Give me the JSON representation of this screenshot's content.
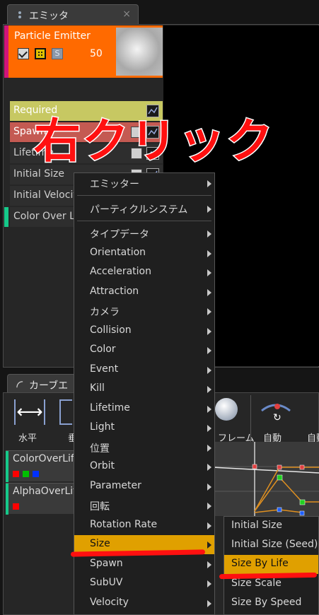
{
  "emitter_tab": {
    "label": "エミッタ",
    "close": "×"
  },
  "emitter": {
    "name": "Particle Emitter",
    "count": "50",
    "solo_label": "S",
    "modules": [
      {
        "label": "Required"
      },
      {
        "label": "Spawn"
      },
      {
        "label": "Lifetime"
      },
      {
        "label": "Initial Size"
      },
      {
        "label": "Initial Velocity"
      },
      {
        "label": "Color Over Life"
      }
    ]
  },
  "annotation": {
    "text": "右クリック",
    "color": "#ff1010"
  },
  "curve_tab": {
    "label": "カーブエディタ"
  },
  "curve_toolbar": {
    "horizontal": "水平",
    "vertical": "垂直",
    "frame": "フレーム",
    "auto": "自動",
    "auto2": "自動"
  },
  "curve_tracks": [
    {
      "label": "ColorOverLife",
      "swatches": [
        "#ff0000",
        "#00c000",
        "#0030ff"
      ]
    },
    {
      "label": "AlphaOverLife",
      "swatches": [
        "#ff0000"
      ]
    }
  ],
  "context_menu": {
    "items": [
      {
        "label": "エミッター",
        "submenu": true
      },
      {
        "label": "パーティクルシステム",
        "submenu": true
      },
      {
        "label": "タイプデータ",
        "submenu": true
      },
      {
        "label": "Orientation",
        "submenu": true
      },
      {
        "label": "Acceleration",
        "submenu": true
      },
      {
        "label": "Attraction",
        "submenu": true
      },
      {
        "label": "カメラ",
        "submenu": true
      },
      {
        "label": "Collision",
        "submenu": true
      },
      {
        "label": "Color",
        "submenu": true
      },
      {
        "label": "Event",
        "submenu": true
      },
      {
        "label": "Kill",
        "submenu": true
      },
      {
        "label": "Lifetime",
        "submenu": true
      },
      {
        "label": "Light",
        "submenu": true
      },
      {
        "label": "位置",
        "submenu": true
      },
      {
        "label": "Orbit",
        "submenu": true
      },
      {
        "label": "Parameter",
        "submenu": true
      },
      {
        "label": "回転",
        "submenu": true
      },
      {
        "label": "Rotation Rate",
        "submenu": true
      },
      {
        "label": "Size",
        "submenu": true,
        "selected": true
      },
      {
        "label": "Spawn",
        "submenu": true
      },
      {
        "label": "SubUV",
        "submenu": true
      },
      {
        "label": "Velocity",
        "submenu": true
      }
    ]
  },
  "size_submenu": {
    "items": [
      {
        "label": "Initial Size"
      },
      {
        "label": "Initial Size (Seed)"
      },
      {
        "label": "Size By Life",
        "selected": true
      },
      {
        "label": "Size Scale"
      },
      {
        "label": "Size By Speed"
      }
    ]
  },
  "colors": {
    "highlight": "#e0a000",
    "emitter_header": "#ff6a00",
    "accent_green": "#16c98a"
  }
}
